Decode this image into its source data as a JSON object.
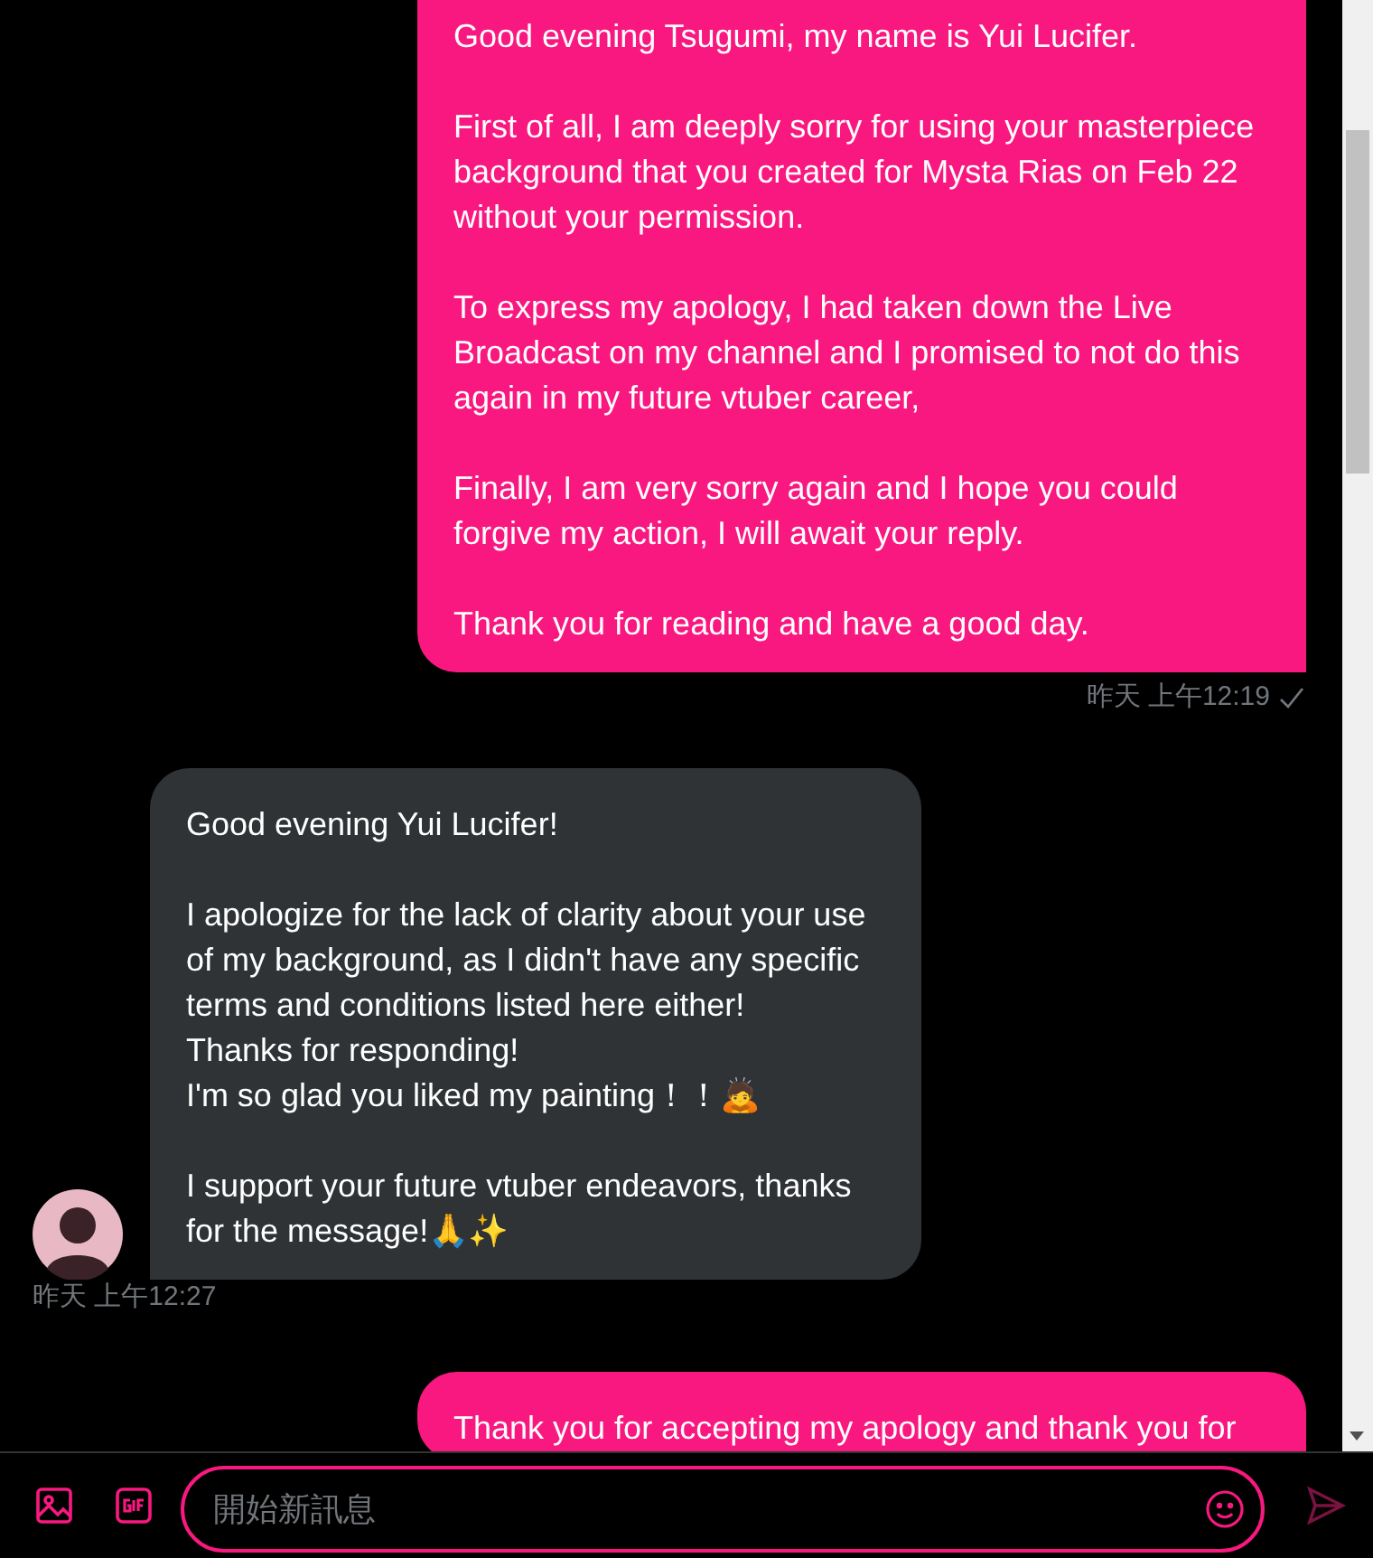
{
  "messages": [
    {
      "kind": "sent",
      "groups": [
        [
          "Good evening Tsugumi, my name is Yui Lucifer."
        ],
        [
          "First of all, I am deeply sorry for using your masterpiece background that you created for Mysta Rias on Feb 22 without your permission."
        ],
        [
          "To express my apology, I had taken down the Live Broadcast on my channel and I promised to not do this again in my future vtuber career,"
        ],
        [
          "Finally, I am very sorry again and I hope you could forgive my action, I will await your reply."
        ],
        [
          "Thank you for reading and have a good day."
        ]
      ],
      "time": "昨天 上午12:19",
      "read": true
    },
    {
      "kind": "received",
      "groups": [
        [
          "Good evening Yui Lucifer!"
        ],
        [
          "I apologize for the lack of clarity about your use of my background, as I didn't have any specific terms and conditions listed here either!",
          "Thanks for responding!",
          "I'm so glad you liked my painting！！🙇"
        ],
        [
          "I support your future vtuber endeavors, thanks for the message!🙏✨"
        ]
      ],
      "time": "昨天 上午12:27"
    },
    {
      "kind": "sent",
      "groups": [
        [
          "Thank you for accepting my apology and thank you for"
        ]
      ]
    }
  ],
  "composer": {
    "placeholder": "開始新訊息"
  }
}
